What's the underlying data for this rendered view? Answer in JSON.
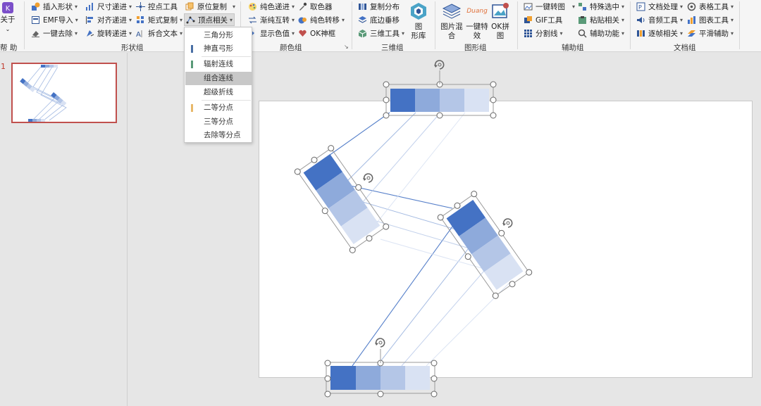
{
  "ribbon": {
    "about": {
      "label": "关于",
      "caret": "⌄"
    },
    "help_label": "帮 助",
    "shape_group": {
      "label": "形状组",
      "insert_shape": "插入形状",
      "emf_import": "EMF导入",
      "one_click_remove": "一键去除",
      "size_increment": "尺寸递进",
      "align_increment": "对齐递进",
      "rotate_increment": "旋转递进",
      "control_point_tool": "控点工具",
      "matrix_copy": "矩式复制",
      "split_text": "拆合文本",
      "in_place_copy": "原位复制",
      "vertex_related": "顶点相关"
    },
    "color_group": {
      "label": "颜色组",
      "solid_increment": "纯色递进",
      "gradient_solid": "渐纯互转",
      "show_color_value": "显示色值",
      "color_picker": "取色器",
      "solid_transfer": "纯色转移",
      "ok_eyedropper": "OK神框"
    },
    "three_d_group": {
      "label": "三维组",
      "copy_distribute": "复制分布",
      "bottom_perpendicular": "底边垂移",
      "three_d_tools": "三维工具",
      "shape_library_line1": "图",
      "shape_library_line2": "形库"
    },
    "graphic_group": {
      "label": "图形组",
      "image_mix_line1": "图片混",
      "image_mix_line2": "合",
      "one_click_effect_line1": "一键特",
      "one_click_effect_line2": "效",
      "ok_puzzle_line1": "OK拼",
      "ok_puzzle_line2": "图",
      "duang_text": "Duang"
    },
    "assist_group": {
      "label": "辅助组",
      "one_click_convert": "一键转图",
      "gif_tool": "GIF工具",
      "split_line": "分割线",
      "special_select": "特殊选中",
      "paste_related": "粘贴相关",
      "assist_function": "辅助功能"
    },
    "doc_group": {
      "label": "文档组",
      "doc_processing": "文档处理",
      "audio_tools": "音频工具",
      "frame_related": "逐帧相关",
      "table_tools": "表格工具",
      "chart_tools": "图表工具",
      "smooth_assist": "平滑辅助"
    }
  },
  "dropdown": {
    "items": [
      {
        "label": "三角分形",
        "mark": ""
      },
      {
        "label": "抻直弓形",
        "mark": "#4a6fa5"
      },
      {
        "label": "辐射连线",
        "mark": "#5a9a78"
      },
      {
        "label": "组合连线",
        "mark": ""
      },
      {
        "label": "超级折线",
        "mark": ""
      },
      {
        "label": "二等分点",
        "mark": "#e8b86a"
      },
      {
        "label": "三等分点",
        "mark": ""
      },
      {
        "label": "去除等分点",
        "mark": ""
      }
    ],
    "highlighted_index": 3
  },
  "slides": {
    "current_number": "1"
  },
  "colors": {
    "shade1": "#4472c4",
    "shade2": "#8eaadb",
    "shade3": "#b4c6e7",
    "shade4": "#d9e2f3",
    "accent": "#c0504d",
    "connector": "#4472c4"
  }
}
